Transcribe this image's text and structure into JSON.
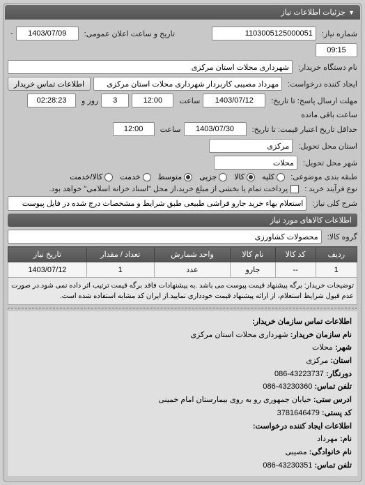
{
  "panel_title": "جزئیات اطلاعات نیاز",
  "request_number_label": "شماره نیاز:",
  "request_number": "1103005125000051",
  "announce_label": "تاریخ و ساعت اعلان عمومی:",
  "announce_date": "1403/07/09",
  "announce_time": "09:15",
  "buyer_org_label": "نام دستگاه خریدار:",
  "buyer_org": "شهرداری محلات استان مرکزی",
  "creator_label": "ایجاد کننده درخواست:",
  "creator": "مهرداد مصیبی کاربردار  شهرداری محلات استان مرکزی",
  "contact_btn": "اطلاعات تماس خریدار",
  "deadline_label": "مهلت ارسال پاسخ: تا تاریخ:",
  "deadline_date": "1403/07/12",
  "deadline_saat": "ساعت",
  "deadline_time": "12:00",
  "remain_days": "3",
  "remain_days_label": "روز و",
  "remain_time": "02:28:23",
  "remain_label": "ساعت باقی مانده",
  "valid_label": "حداقل تاریخ اعتبار قیمت: تا تاریخ:",
  "valid_date": "1403/07/30",
  "valid_time": "12:00",
  "delivery_province_label": "استان محل تحویل:",
  "delivery_province": "مرکزی",
  "delivery_city_label": "شهر محل تحویل:",
  "delivery_city": "محلات",
  "category_label": "طبقه بندی موضوعی:",
  "cat_all": "کلیه",
  "cat_goods": "کالا",
  "cat_part": "جزیی",
  "cat_medium": "متوسط",
  "cat_service": "خدمت",
  "cat_both": "کالا/خدمت",
  "process_label": "نوع فرآیند خرید :",
  "process_text": "پرداخت تمام یا بخشی از مبلغ خرید،از محل \"اسناد خزانه اسلامی\" خواهد بود.",
  "desc_label": "شرح کلی نیاز:",
  "desc_text": "استعلام بهاء خرید جارو فراشی طبیعی طبق شرایط و مشخصات درج شده در فایل پیوست",
  "goods_section": "اطلاعات کالاهای مورد نیاز",
  "goods_group_label": "گروه کالا:",
  "goods_group": "محصولات کشاورزی",
  "th_row": "ردیف",
  "th_code": "کد کالا",
  "th_name": "نام کالا",
  "th_unit": "واحد شمارش",
  "th_qty": "تعداد / مقدار",
  "th_date": "تاریخ نیاز",
  "td_row": "1",
  "td_code": "--",
  "td_name": "جارو",
  "td_unit": "عدد",
  "td_qty": "1",
  "td_date": "1403/07/12",
  "notes_label": "توضیحات خریدار:",
  "notes_text": "برگه پیشنهاد قیمت پیوست می باشد .به پیشنهادات فاقد برگه قیمت ترتیب اثر داده نمی شود.در صورت عدم قبول شرایط استعلام، از ارائه پیشنهاد قیمت خودداری نمایید.از ایران کد مشابه استفاده شده است.",
  "contact_title": "اطلاعات تماس سازمان خریدار:",
  "contact_org_label": "نام سازمان خریدار:",
  "contact_org": "شهرداری محلات استان مرکزی",
  "contact_city_label": "شهر:",
  "contact_city": "محلات",
  "contact_province_label": "استان:",
  "contact_province": "مرکزی",
  "fax_label": "دورنگار:",
  "fax": "43223737-086",
  "phone_label": "تلفن تماس:",
  "phone": "43230360-086",
  "address_label": "ادرس ستی:",
  "address": "خیابان جمهوری رو به روی بیمارستان امام خمینی",
  "postal_label": "کد پستی:",
  "postal": "3781646479",
  "creator_info_title": "اطلاعات ایجاد کننده درخواست:",
  "creator_name_label": "نام:",
  "creator_name": "مهرداد",
  "creator_lastname_label": "نام خانوادگی:",
  "creator_lastname": "مصیبی",
  "creator_phone_label": "تلفن تماس:",
  "creator_phone": "43230351-086"
}
